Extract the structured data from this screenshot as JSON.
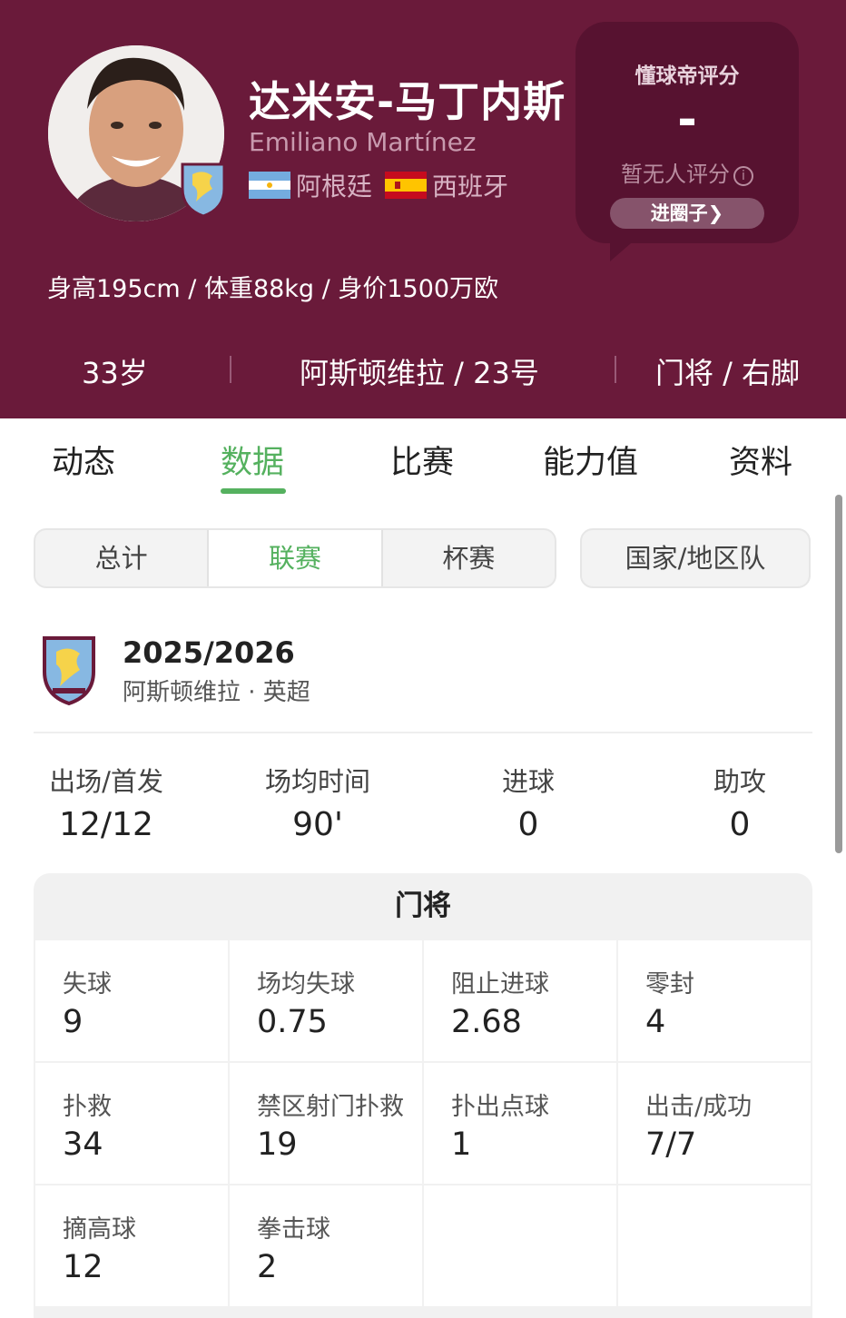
{
  "player": {
    "name_cn": "达米安-马丁内斯",
    "name_en": "Emiliano Martínez",
    "nationality_1": "阿根廷",
    "nationality_2": "西班牙",
    "bio": "身高195cm / 体重88kg / 身价1500万欧",
    "age": "33岁",
    "club_number": "阿斯顿维拉 / 23号",
    "position_foot": "门将 / 右脚"
  },
  "rating": {
    "title": "懂球帝评分",
    "value": "-",
    "note": "暂无人评分",
    "info_icon": "i",
    "button_label": "进圈子❯"
  },
  "tabs": [
    "动态",
    "数据",
    "比赛",
    "能力值",
    "资料"
  ],
  "active_tab": "数据",
  "filters": {
    "segments": [
      "总计",
      "联赛",
      "杯赛"
    ],
    "active": "联赛",
    "national": "国家/地区队"
  },
  "season": {
    "year": "2025/2026",
    "team_league": "阿斯顿维拉 · 英超"
  },
  "summary": [
    {
      "label": "出场/首发",
      "value": "12/12"
    },
    {
      "label": "场均时间",
      "value": "90'"
    },
    {
      "label": "进球",
      "value": "0"
    },
    {
      "label": "助攻",
      "value": "0"
    }
  ],
  "goalkeeping": {
    "title": "门将",
    "rows": [
      [
        {
          "label": "失球",
          "value": "9"
        },
        {
          "label": "场均失球",
          "value": "0.75"
        },
        {
          "label": "阻止进球",
          "value": "2.68"
        },
        {
          "label": "零封",
          "value": "4"
        }
      ],
      [
        {
          "label": "扑救",
          "value": "34"
        },
        {
          "label": "禁区射门扑救",
          "value": "19"
        },
        {
          "label": "扑出点球",
          "value": "1"
        },
        {
          "label": "出击/成功",
          "value": "7/7"
        }
      ],
      [
        {
          "label": "摘高球",
          "value": "12"
        },
        {
          "label": "拳击球",
          "value": "2"
        },
        {
          "label": "",
          "value": ""
        },
        {
          "label": "",
          "value": ""
        }
      ]
    ]
  },
  "colors": {
    "header_bg": "#6a1a3a",
    "accent_green": "#55b15f",
    "rating_box": "#571230"
  },
  "icons": {
    "club_badge": "aston-villa-badge-icon",
    "flag_1": "argentina-flag-icon",
    "flag_2": "spain-flag-icon"
  }
}
